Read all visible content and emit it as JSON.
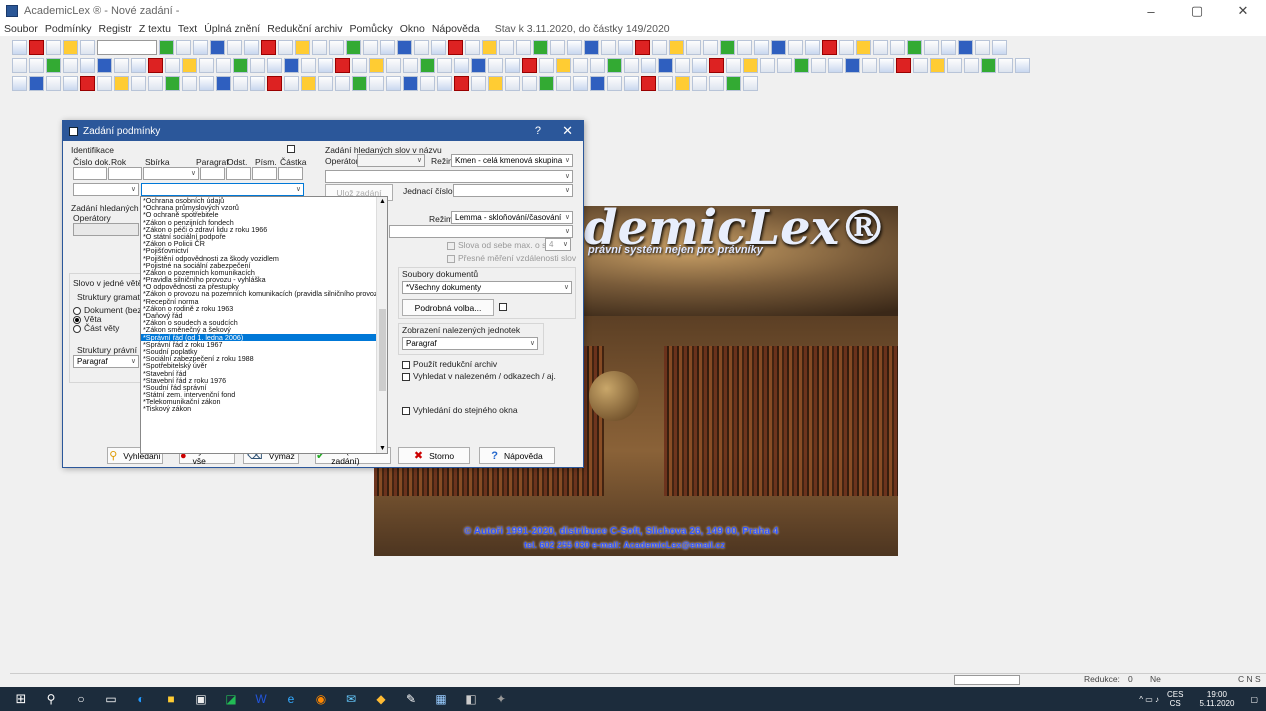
{
  "window": {
    "title": "AcademicLex ® - Nové zadání -",
    "minimize": "–",
    "restore": "▢",
    "close": "✕"
  },
  "menu": [
    "Soubor",
    "Podmínky",
    "Registr",
    "Z textu",
    "Text",
    "Úplná znění",
    "Redukční archiv",
    "Pomůcky",
    "Okno",
    "Nápověda"
  ],
  "menu_status": "Stav k 3.11.2020, do částky 149/2020",
  "splash": {
    "logo": "demicLex®",
    "subtitle": "právní systém nejen pro právníky",
    "copyright": "© Autoři 1991-2020, distribuce C-Soft, Slichova 26, 149 00, Praha 4",
    "contact": "tel. 602 255 030    e-mail: AcademicLex@email.cz"
  },
  "dialog": {
    "title": "Zadání podmínky",
    "help": "?",
    "close": "✕",
    "identifikace": "Identifikace",
    "cols": {
      "cislo": "Číslo dok.",
      "rok": "Rok",
      "sbirka": "Sbírka",
      "paragraf": "Paragraf",
      "odst": "Odst.",
      "pism": "Písm.",
      "castka": "Částka"
    },
    "zadani_nazev": "Zadání hledaných slov v názvu",
    "operatory": "Operátory",
    "rezim": "Režim",
    "rezim1": "Kmen - celá kmenová skupina",
    "rezim2": "Lemma - skloňování/časování",
    "jednaci": "Jednací číslo",
    "zadani_text": "Zadání hledaných sl",
    "operatory2": "Operátory",
    "slova_od": "Slova od sebe max. o slov",
    "slova_val": "4",
    "presne": "Přesné měření vzdálenosti slov",
    "slovo_vete": "Slovo v jedné větě u",
    "struktury_gram": "Struktury gramatick",
    "r_dokument": "Dokument (bez n",
    "r_veta": "Věta",
    "r_cast": "Část věty",
    "struktury_pravni": "Struktury právní",
    "paragraf_sel": "Paragraf",
    "soubory": "Soubory dokumentů",
    "soubory_val": "*Všechny dokumenty",
    "podrobna": "Podrobná volba...",
    "zobrazeni": "Zobrazení nalezených jednotek",
    "zobrazeni_val": "Paragraf",
    "pouzit": "Použít redukční archiv",
    "vyhledat_v": "Vyhledat v nalezeném / odkazech / aj.",
    "vyhledani_okno": "Vyhledání do stejného okna",
    "btn_vyhledani": "Vyhledání",
    "btn_vymaz_vse": "Výmaz vše",
    "btn_vymaz": "Výmaz",
    "btn_ok": "OK (další zadání)",
    "btn_storno": "Storno",
    "btn_napoveda": "Nápověda",
    "btn_dalsi": "Ulož zadání"
  },
  "dropdown_items": [
    "*Ochrana osobních údajů",
    "*Ochrana průmyslových vzorů",
    "*O ochraně spotřebitele",
    "*Zákon o penzijních fondech",
    "*Zákon o péči o zdraví lidu z roku 1966",
    "*O státní sociální podpoře",
    "*Zákon o Policii ČR",
    "*Pojišťovnictví",
    "*Pojištění odpovědnosti za škody vozidlem",
    "*Pojistné na sociální zabezpečení",
    "*Zákon o pozemních komunikacích",
    "*Pravidla silničního provozu - vyhláška",
    "*O odpovědnosti za přestupky",
    "*Zákon o provozu na pozemních komunikacích (pravidla silničního provozu)",
    "*Recepční norma",
    "*Zákon o rodině z roku 1963",
    "*Daňový řád",
    "*Zákon o soudech a soudcích",
    "*Zákon směnečný a šekový",
    "*Správní řád (od 1. ledna 2006)",
    "*Správní řád z roku 1967",
    "*Soudní poplatky",
    "*Sociální zabezpečení z roku 1988",
    "*Spotřebitelský úvěr",
    "*Stavební řád",
    "*Stavební řád z roku 1976",
    "*Soudní řád správní",
    "*Státní zem. intervenční fond",
    "*Telekomunikační zákon",
    "*Tiskový zákon"
  ],
  "dropdown_selected_index": 19,
  "statusbar": {
    "redukce": "Redukce:",
    "redukce_val": "0",
    "ne": "Ne",
    "cns": "C N S"
  },
  "taskbar": {
    "lang1": "CES",
    "lang2": "CS",
    "time": "19:00",
    "date": "5.11.2020"
  },
  "colors": {
    "titlebar_dialog": "#2b579a",
    "selection": "#0078d7",
    "taskbar": "#1c2c3c"
  }
}
